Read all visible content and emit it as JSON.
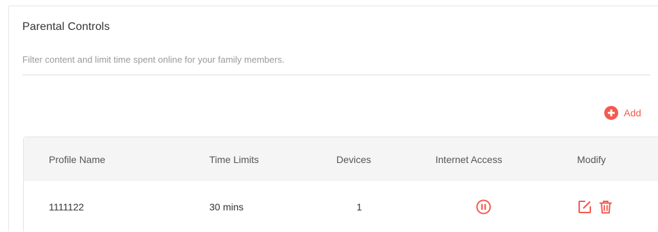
{
  "section": {
    "title": "Parental Controls",
    "subtitle": "Filter content and limit time spent online for your family members."
  },
  "add_button": {
    "label": "Add",
    "icon": "plus-circle-icon"
  },
  "table": {
    "columns": [
      "Profile Name",
      "Time Limits",
      "Devices",
      "Internet Access",
      "Modify"
    ],
    "rows": [
      {
        "profile_name": "1111122",
        "time_limits": "30 mins",
        "devices": "1",
        "internet_access_icon": "pause-circle-icon",
        "modify_icons": [
          "edit-icon",
          "delete-icon"
        ]
      }
    ]
  },
  "colors": {
    "accent": "#f45a4f",
    "header_bg": "#f5f5f5",
    "subtitle_text": "#9a9a9a"
  }
}
